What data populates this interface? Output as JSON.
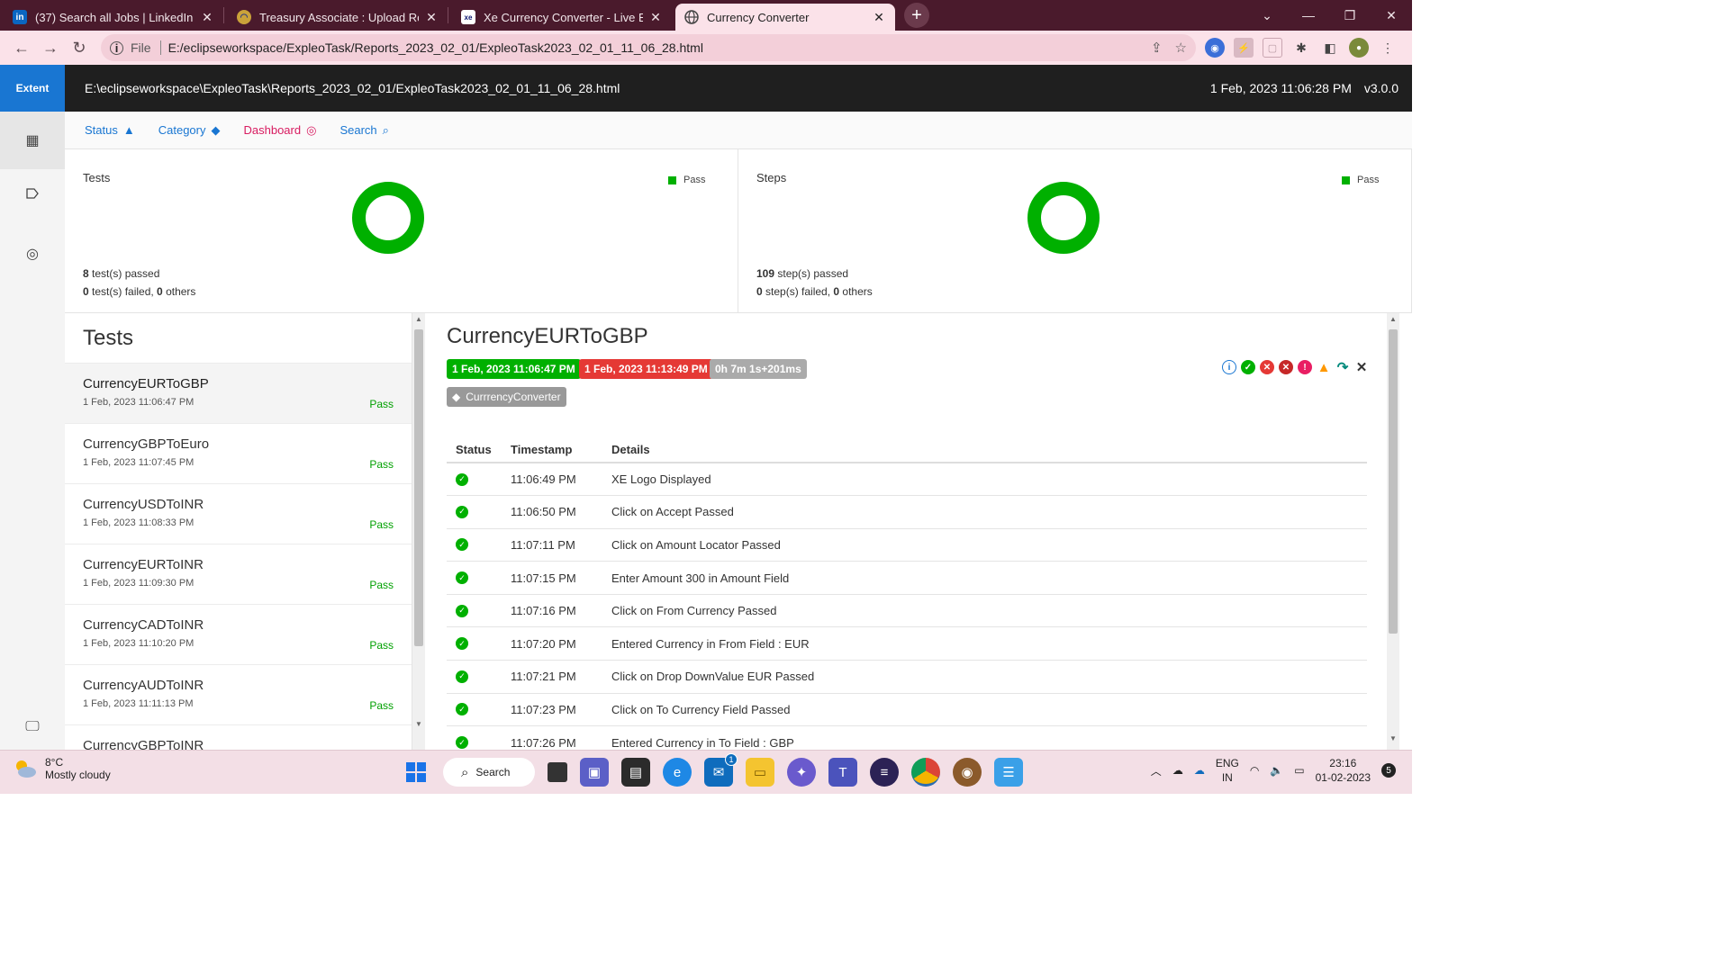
{
  "browser": {
    "tabs": [
      {
        "title": "(37) Search all Jobs | LinkedIn",
        "icon": "linkedin-icon",
        "active": false
      },
      {
        "title": "Treasury Associate : Upload Resu",
        "icon": "upload-icon",
        "active": false
      },
      {
        "title": "Xe Currency Converter - Live Exch",
        "icon": "xe-icon",
        "active": false
      },
      {
        "title": "Currency Converter",
        "icon": "globe-icon",
        "active": true
      }
    ],
    "file_label": "File",
    "url": "E:/eclipseworkspace/ExpleoTask/Reports_2023_02_01/ExpleoTask2023_02_01_11_06_28.html"
  },
  "extent": {
    "brand": "Extent",
    "report_path": "E:\\eclipseworkspace\\ExpleoTask\\Reports_2023_02_01/ExpleoTask2023_02_01_11_06_28.html",
    "report_date": "1 Feb, 2023 11:06:28 PM",
    "version": "v3.0.0"
  },
  "nav": {
    "status": "Status",
    "category": "Category",
    "dashboard": "Dashboard",
    "search": "Search"
  },
  "dashboard": {
    "tests": {
      "title": "Tests",
      "legend": "Pass",
      "passed_count": "8",
      "passed_text": " test(s) passed",
      "failed_count": "0",
      "failed_text": " test(s) failed, ",
      "others_count": "0",
      "others_text": " others",
      "pass_fraction": 1.0
    },
    "steps": {
      "title": "Steps",
      "legend": "Pass",
      "passed_count": "109",
      "passed_text": " step(s) passed",
      "failed_count": "0",
      "failed_text": " step(s) failed, ",
      "others_count": "0",
      "others_text": " others",
      "pass_fraction": 1.0
    }
  },
  "test_list": {
    "heading": "Tests",
    "items": [
      {
        "name": "CurrencyEURToGBP",
        "time": "1 Feb, 2023 11:06:47 PM",
        "status": "Pass"
      },
      {
        "name": "CurrencyGBPToEuro",
        "time": "1 Feb, 2023 11:07:45 PM",
        "status": "Pass"
      },
      {
        "name": "CurrencyUSDToINR",
        "time": "1 Feb, 2023 11:08:33 PM",
        "status": "Pass"
      },
      {
        "name": "CurrencyEURToINR",
        "time": "1 Feb, 2023 11:09:30 PM",
        "status": "Pass"
      },
      {
        "name": "CurrencyCADToINR",
        "time": "1 Feb, 2023 11:10:20 PM",
        "status": "Pass"
      },
      {
        "name": "CurrencyAUDToINR",
        "time": "1 Feb, 2023 11:11:13 PM",
        "status": "Pass"
      },
      {
        "name": "CurrencyGBPToINR",
        "time": "",
        "status": ""
      }
    ]
  },
  "detail": {
    "title": "CurrencyEURToGBP",
    "start": "1 Feb, 2023 11:06:47 PM",
    "end": "1 Feb, 2023 11:13:49 PM",
    "duration": "0h 7m 1s+201ms",
    "category": "CurrrencyConverter",
    "columns": [
      "Status",
      "Timestamp",
      "Details"
    ],
    "rows": [
      {
        "time": "11:06:49 PM",
        "details": "XE Logo Displayed"
      },
      {
        "time": "11:06:50 PM",
        "details": "Click on Accept Passed"
      },
      {
        "time": "11:07:11 PM",
        "details": "Click on Amount Locator Passed"
      },
      {
        "time": "11:07:15 PM",
        "details": "Enter Amount 300 in Amount Field"
      },
      {
        "time": "11:07:16 PM",
        "details": "Click on From Currency Passed"
      },
      {
        "time": "11:07:20 PM",
        "details": "Entered Currency in From Field : EUR"
      },
      {
        "time": "11:07:21 PM",
        "details": "Click on Drop DownValue EUR Passed"
      },
      {
        "time": "11:07:23 PM",
        "details": "Click on To Currency Field Passed"
      },
      {
        "time": "11:07:26 PM",
        "details": "Entered Currency in To Field : GBP"
      }
    ]
  },
  "taskbar": {
    "temp": "8°C",
    "condition": "Mostly cloudy",
    "search": "Search",
    "lang1": "ENG",
    "lang2": "IN",
    "time": "23:16",
    "date": "01-02-2023",
    "notifications": "5",
    "mail_badge": "1"
  },
  "colors": {
    "pass": "#00b000",
    "fail": "#e53935",
    "accent": "#1976d2",
    "header": "#1f1f1f"
  }
}
